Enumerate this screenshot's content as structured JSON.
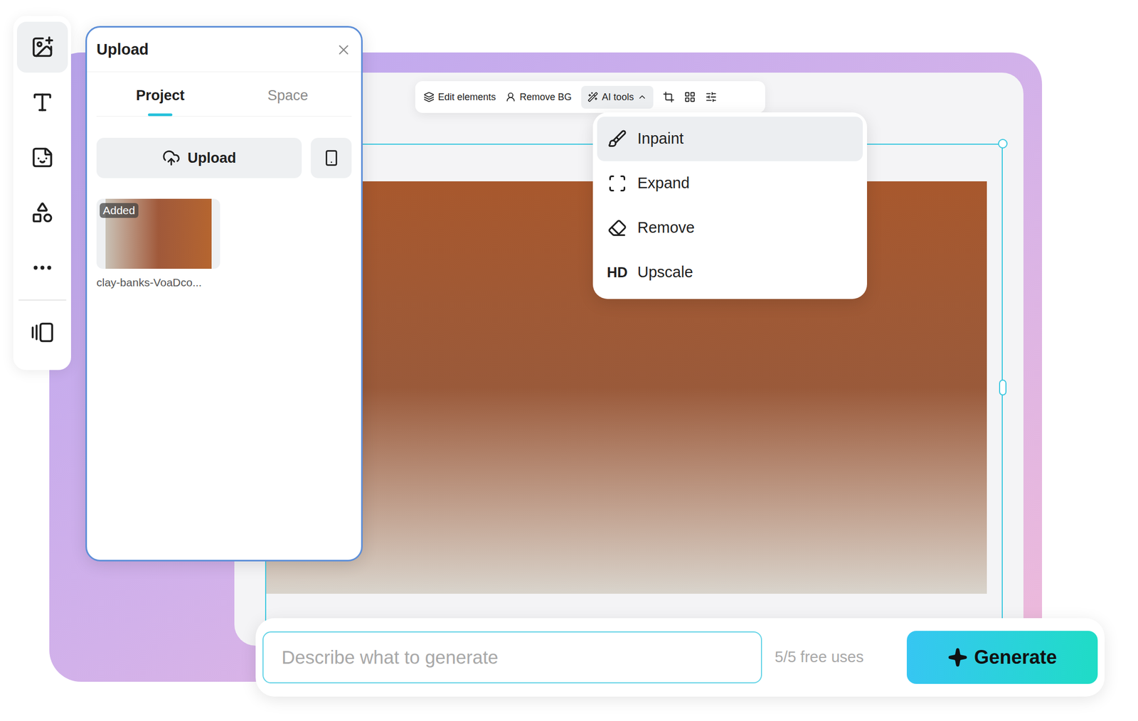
{
  "sidebar": {
    "items": [
      {
        "selected": true
      },
      {
        "selected": false
      },
      {
        "selected": false
      },
      {
        "selected": false
      },
      {
        "selected": false
      },
      {
        "selected": false
      }
    ]
  },
  "upload_panel": {
    "title": "Upload",
    "tabs": [
      {
        "label": "Project",
        "selected": true
      },
      {
        "label": "Space",
        "selected": false
      }
    ],
    "upload_button": "Upload",
    "assets": [
      {
        "name": "clay-banks-VoaDco...",
        "badge": "Added"
      }
    ]
  },
  "toolbar": {
    "items": [
      "Edit elements",
      "Remove BG"
    ],
    "ai_tools": {
      "label": "AI tools",
      "expanded": true
    }
  },
  "ai_tools_menu": [
    {
      "label": "Inpaint",
      "selected": true,
      "badge": ""
    },
    {
      "label": "Expand",
      "selected": false,
      "badge": ""
    },
    {
      "label": "Remove",
      "selected": false,
      "badge": ""
    },
    {
      "label": "Upscale",
      "selected": false,
      "badge": "HD"
    }
  ],
  "prompt": {
    "placeholder": "Describe what to generate",
    "usage": "5/5 free uses",
    "button": "Generate"
  }
}
